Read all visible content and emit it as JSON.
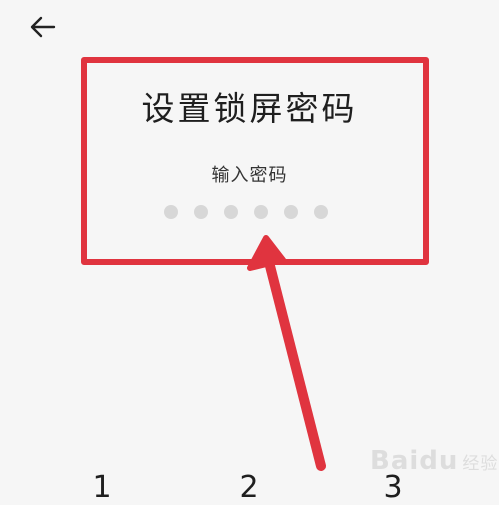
{
  "header": {
    "back_icon": "arrow-left-icon"
  },
  "title": "设置锁屏密码",
  "subtitle": "输入密码",
  "pin": {
    "length": 6,
    "entered": 0
  },
  "keypad": {
    "keys": [
      "1",
      "2",
      "3"
    ]
  },
  "annotation": {
    "box_color": "#e0343f",
    "arrow_color": "#e0343f"
  },
  "watermark": {
    "brand": "Baidu",
    "suffix": "经验"
  }
}
